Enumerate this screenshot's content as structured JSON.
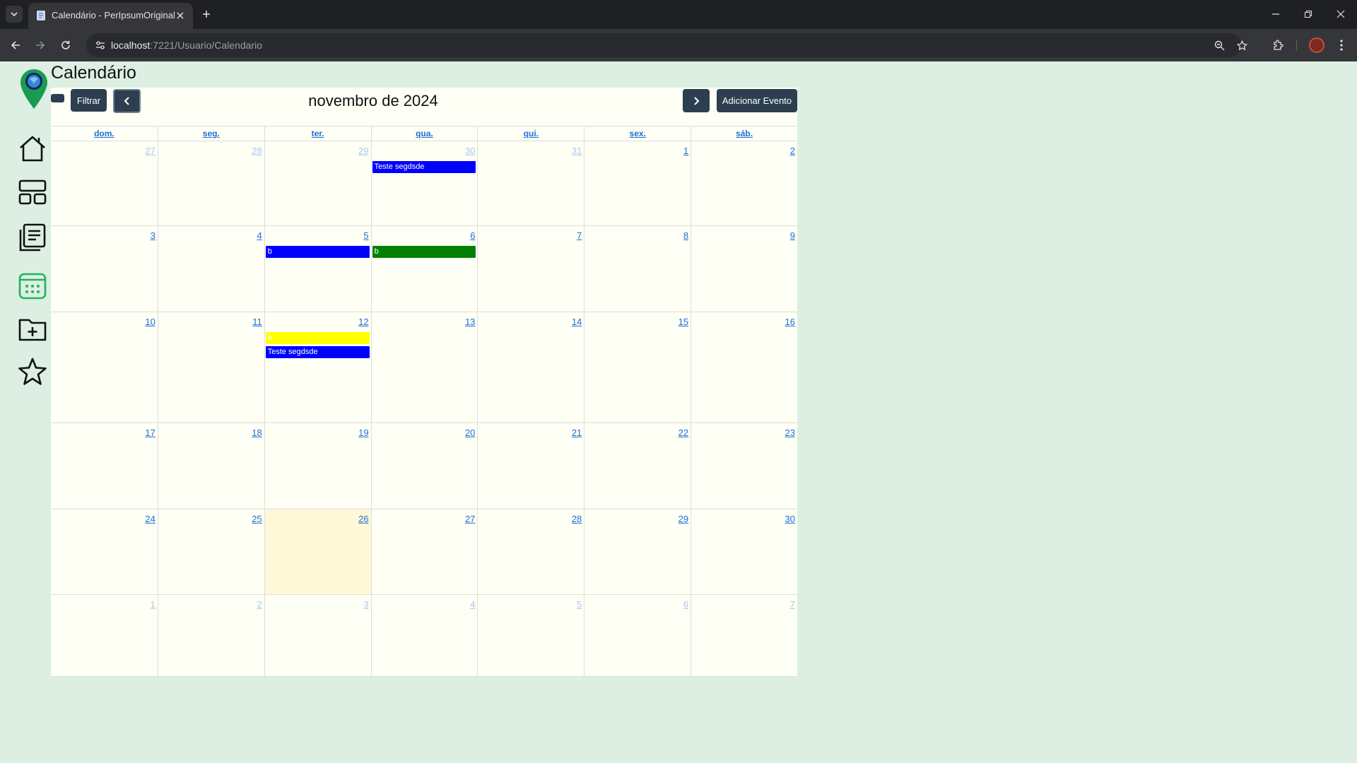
{
  "browser": {
    "tab_title": "Calendário - PerIpsumOriginal",
    "url_host": "localhost",
    "url_rest": ":7221/Usuario/Calendario"
  },
  "page": {
    "title": "Calendário",
    "filter_label": "Filtrar",
    "add_event_label": "Adicionar Evento",
    "month_title": "novembro de 2024"
  },
  "colors": {
    "background": "#dcefe2",
    "calendar_bg": "#fefff5",
    "header_button": "#2c3e50",
    "link": "#1e6ed6",
    "today": "#fef8d8",
    "nav_active_icon": "#22b35a"
  },
  "sidebar": [
    {
      "name": "home-icon",
      "active": false
    },
    {
      "name": "dashboard-icon",
      "active": false
    },
    {
      "name": "document-list-icon",
      "active": false
    },
    {
      "name": "calendar-icon",
      "active": true
    },
    {
      "name": "folder-add-icon",
      "active": false
    },
    {
      "name": "star-icon",
      "active": false
    }
  ],
  "calendar": {
    "weekdays": [
      "dom.",
      "seg.",
      "ter.",
      "qua.",
      "qui.",
      "sex.",
      "sáb."
    ],
    "weeks": [
      [
        {
          "d": "27",
          "other": true
        },
        {
          "d": "28",
          "other": true
        },
        {
          "d": "29",
          "other": true
        },
        {
          "d": "30",
          "other": true
        },
        {
          "d": "31",
          "other": true
        },
        {
          "d": "1"
        },
        {
          "d": "2"
        }
      ],
      [
        {
          "d": "3"
        },
        {
          "d": "4"
        },
        {
          "d": "5"
        },
        {
          "d": "6"
        },
        {
          "d": "7"
        },
        {
          "d": "8"
        },
        {
          "d": "9"
        }
      ],
      [
        {
          "d": "10"
        },
        {
          "d": "11"
        },
        {
          "d": "12"
        },
        {
          "d": "13"
        },
        {
          "d": "14"
        },
        {
          "d": "15"
        },
        {
          "d": "16"
        }
      ],
      [
        {
          "d": "17"
        },
        {
          "d": "18"
        },
        {
          "d": "19"
        },
        {
          "d": "20"
        },
        {
          "d": "21"
        },
        {
          "d": "22"
        },
        {
          "d": "23"
        }
      ],
      [
        {
          "d": "24"
        },
        {
          "d": "25"
        },
        {
          "d": "26",
          "today": true
        },
        {
          "d": "27"
        },
        {
          "d": "28"
        },
        {
          "d": "29"
        },
        {
          "d": "30"
        }
      ],
      [
        {
          "d": "1",
          "other": true
        },
        {
          "d": "2",
          "other": true
        },
        {
          "d": "3",
          "other": true
        },
        {
          "d": "4",
          "other": true
        },
        {
          "d": "5",
          "other": true
        },
        {
          "d": "6",
          "other": true
        },
        {
          "d": "7",
          "other": true
        }
      ]
    ],
    "events": [
      {
        "week": 0,
        "day": 3,
        "slot": 0,
        "title": "Teste segdsde",
        "color": "#0000ff",
        "text_color": "#ffffff"
      },
      {
        "week": 1,
        "day": 2,
        "slot": 0,
        "title": "b",
        "color": "#0000ff",
        "text_color": "#ffffff"
      },
      {
        "week": 1,
        "day": 3,
        "slot": 0,
        "title": "b",
        "color": "#008000",
        "text_color": "#ffffff"
      },
      {
        "week": 2,
        "day": 2,
        "slot": 0,
        "title": "b",
        "color": "#ffff00",
        "text_color": "#ffffff"
      },
      {
        "week": 2,
        "day": 2,
        "slot": 1,
        "title": "Teste segdsde",
        "color": "#0000ff",
        "text_color": "#ffffff"
      }
    ]
  }
}
